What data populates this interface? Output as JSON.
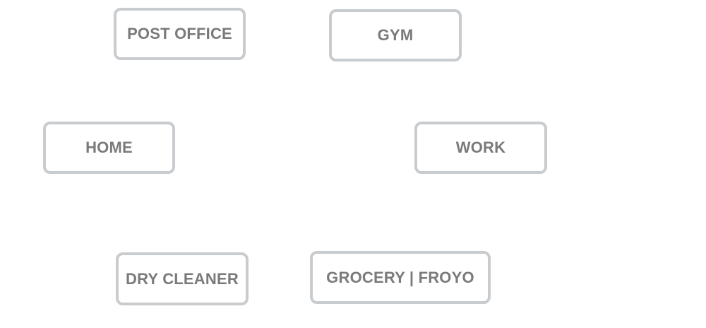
{
  "nodes": {
    "post_office": "POST OFFICE",
    "gym": "GYM",
    "home": "HOME",
    "work": "WORK",
    "dry_cleaner": "DRY CLEANER",
    "grocery_froyo": "GROCERY | FROYO"
  },
  "colors": {
    "node_border": "#c9cccf",
    "node_text": "#7a7a7a",
    "background": "#ffffff"
  }
}
